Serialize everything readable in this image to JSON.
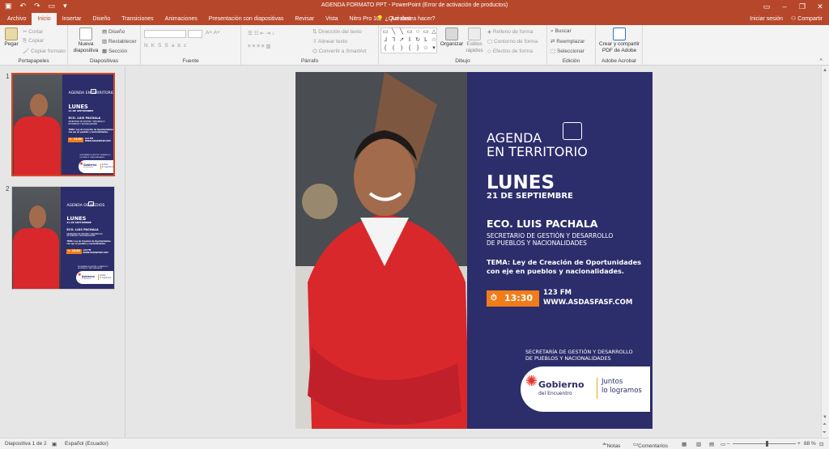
{
  "titlebar": {
    "title": "AGENDA FORMATO PPT - PowerPoint (Error de activación de productos)",
    "icons": [
      "save-icon",
      "undo-icon",
      "redo-icon",
      "present-icon",
      "customize-icon"
    ]
  },
  "tabs": [
    "Archivo",
    "Inicio",
    "Insertar",
    "Diseño",
    "Transiciones",
    "Animaciones",
    "Presentación con diapositivas",
    "Revisar",
    "Vista",
    "Nitro Pro 10",
    "Acrobat"
  ],
  "active_tab": "Inicio",
  "tell_me": "¿Qué desea hacer?",
  "account": {
    "signin": "Iniciar sesión",
    "share": "Compartir"
  },
  "ribbon": {
    "clipboard": {
      "label": "Portapapeles",
      "paste": "Pegar",
      "cut": "Cortar",
      "copy": "Copiar",
      "format_painter": "Copiar formato"
    },
    "slides": {
      "label": "Diapositivas",
      "new_slide": "Nueva diapositiva",
      "layout": "Diseño",
      "reset": "Restablecer",
      "section": "Sección"
    },
    "font": {
      "label": "Fuente",
      "bold": "N",
      "italic": "K",
      "underline": "S",
      "strike": "S",
      "clear": "abc"
    },
    "paragraph": {
      "label": "Párrafo",
      "text_direction": "Dirección del texto",
      "align_text": "Alinear texto",
      "smartart": "Convertir a SmartArt"
    },
    "drawing": {
      "label": "Dibujo",
      "arrange": "Organizar",
      "quick_styles": "Estilos rápidos",
      "fill": "Relleno de forma",
      "outline": "Contorno de forma",
      "effects": "Efectos de forma"
    },
    "editing": {
      "label": "Edición",
      "find": "Buscar",
      "replace": "Reemplazar",
      "select": "Seleccionar"
    },
    "acrobat": {
      "label": "Adobe Acrobat",
      "create": "Crear y compartir PDF de Adobe"
    }
  },
  "thumbnails": [
    {
      "number": "1",
      "heading": "AGENDA EN TERRITORIO",
      "selected": true
    },
    {
      "number": "2",
      "heading": "AGENDA DE MEDIOS",
      "selected": false
    }
  ],
  "slide": {
    "heading_line1": "AGENDA",
    "heading_line2": "EN TERRITORIO",
    "day": "LUNES",
    "date": "21 DE SEPTIEMBRE",
    "name": "ECO. LUIS PACHALA",
    "role_line1": "SECRETARIO DE GESTIÓN Y DESARROLLO",
    "role_line2": "DE PUEBLOS Y NACIONALIDADES",
    "topic_line1": "TEMA: Ley de Creación de Oportunidades",
    "topic_line2": "con eje en pueblos y nacionalidades.",
    "time": "13:30",
    "fm": "123 FM",
    "web": "WWW.ASDASFASF.COM",
    "secretariat_line1": "SECRETARÍA DE GESTIÓN Y DESARROLLO",
    "secretariat_line2": "DE PUEBLOS Y NACIONALIDADES",
    "logo_main": "Gobierno",
    "logo_sub": "del Encuentro",
    "logo_slogan1": "Juntos",
    "logo_slogan2": "lo logramos",
    "panel_color": "#2c2d6b",
    "accent_color": "#f07d1a"
  },
  "statusbar": {
    "slide_count": "Diapositiva 1 de 2",
    "language": "Español (Ecuador)",
    "notes": "Notas",
    "comments": "Comentarios",
    "zoom": "88 %"
  }
}
